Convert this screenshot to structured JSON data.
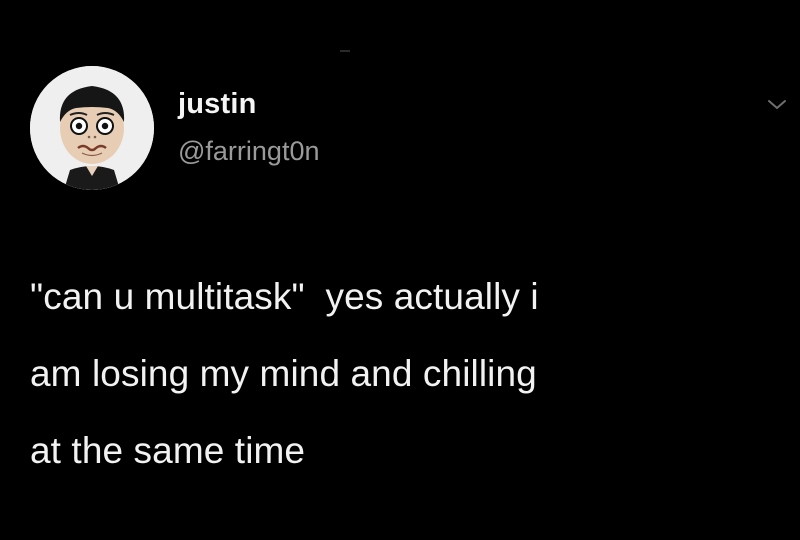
{
  "tweet": {
    "display_name": "justin",
    "handle": "@farringt0n",
    "text_lines": [
      "\"can u multitask\"  yes actually i",
      "am losing my mind and chilling",
      "at the same time"
    ]
  },
  "icons": {
    "avatar": "avatar-cartoon-face-icon",
    "menu": "chevron-down-icon"
  },
  "colors": {
    "background": "#000000",
    "text": "#f2f2f2",
    "handle": "#9a9a9a"
  }
}
